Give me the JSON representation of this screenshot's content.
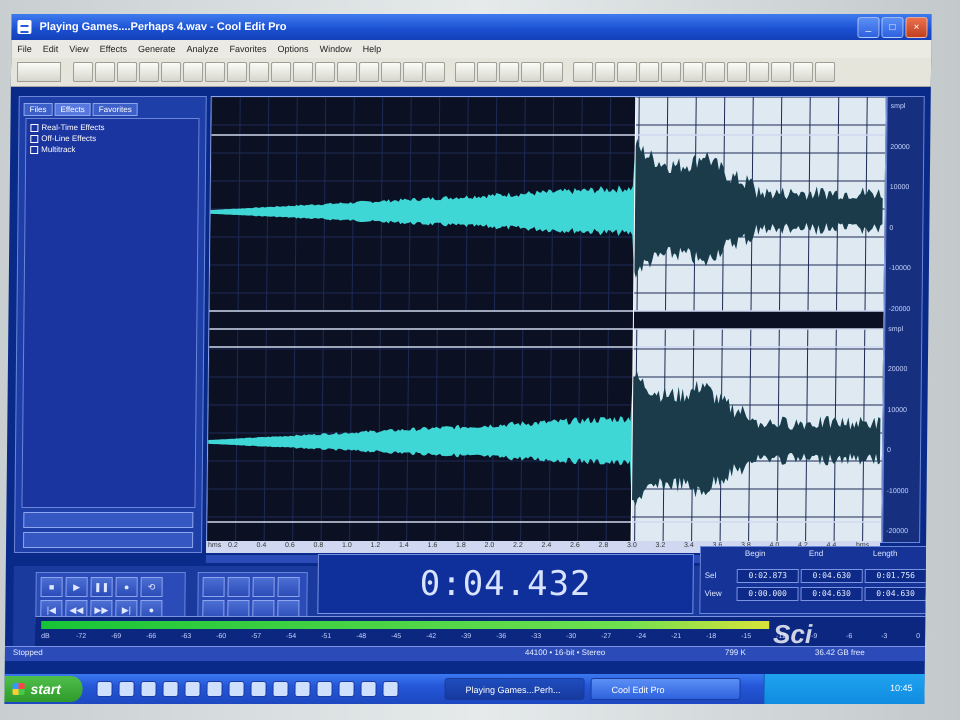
{
  "window": {
    "title": "Playing Games....Perhaps 4.wav - Cool Edit Pro",
    "min": "_",
    "max": "□",
    "close": "×"
  },
  "menu": [
    "File",
    "Edit",
    "View",
    "Effects",
    "Generate",
    "Analyze",
    "Favorites",
    "Options",
    "Window",
    "Help"
  ],
  "left_panel": {
    "tabs": [
      "Files",
      "Effects",
      "Favorites"
    ],
    "tree": [
      "Real-Time Effects",
      "Off-Line Effects",
      "Multitrack"
    ]
  },
  "ruler_right": [
    "smpl",
    "20000",
    "10000",
    "0",
    "-10000",
    "-20000",
    "smpl",
    "20000",
    "10000",
    "0",
    "-10000",
    "-20000"
  ],
  "time_ruler": {
    "unit": "hms",
    "ticks": [
      "0.2",
      "0.4",
      "0.6",
      "0.8",
      "1.0",
      "1.2",
      "1.4",
      "1.6",
      "1.8",
      "2.0",
      "2.2",
      "2.4",
      "2.6",
      "2.8",
      "3.0",
      "3.2",
      "3.4",
      "3.6",
      "3.8",
      "4.0",
      "4.2",
      "4.4"
    ],
    "end_unit": "hms"
  },
  "transport": {
    "buttons": [
      "■",
      "▶",
      "❚❚",
      "●",
      "⟲",
      "|◀",
      "◀◀",
      "▶▶",
      "▶|",
      "●"
    ]
  },
  "time_display": "0:04.432",
  "selection_view": {
    "headers": [
      "Begin",
      "End",
      "Length"
    ],
    "rows": [
      {
        "label": "Sel",
        "begin": "0:02.873",
        "end": "0:04.630",
        "length": "0:01.756"
      },
      {
        "label": "View",
        "begin": "0:00.000",
        "end": "0:04.630",
        "length": "0:04.630"
      }
    ]
  },
  "level_meter": {
    "value": 0.82,
    "scale": [
      "dB",
      "-72",
      "-69",
      "-66",
      "-63",
      "-60",
      "-57",
      "-54",
      "-51",
      "-48",
      "-45",
      "-42",
      "-39",
      "-36",
      "-33",
      "-30",
      "-27",
      "-24",
      "-21",
      "-18",
      "-15",
      "-12",
      "-9",
      "-6",
      "-3",
      "0"
    ]
  },
  "status": {
    "left": "Stopped",
    "rate": "44100 • 16-bit • Stereo",
    "size": "799 K",
    "free": "36.42 GB free"
  },
  "taskbar": {
    "start": "start",
    "task_active": "Playing Games...Perh...",
    "task_other": "Cool Edit Pro",
    "clock": "10:45"
  },
  "watermark": "Sci"
}
